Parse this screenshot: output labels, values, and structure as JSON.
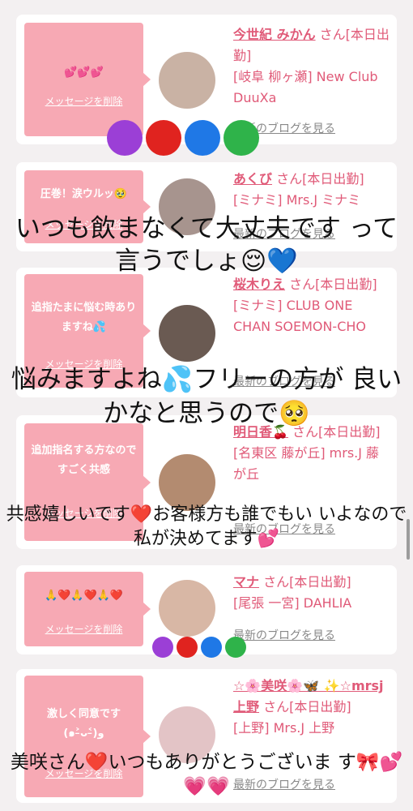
{
  "colors": {
    "background": "#f3f0f1",
    "bubble": "#f7a9b4",
    "accent": "#e05a78",
    "link_gray": "#888888"
  },
  "cards": [
    {
      "bubble_message": "💕💕💕",
      "delete_label": "メッセージを削除",
      "name": "今世紀 みかん",
      "suffix": "さん[本日出勤]",
      "shop": "[岐阜 柳ヶ瀬] New Club DuuXa",
      "blog_label": "最新のブログを見る"
    },
    {
      "bubble_message": "圧巻！涙ウルッ🥹",
      "delete_label": "メッセージを削除",
      "name": "あくび",
      "suffix": "さん[本日出勤]",
      "shop": "[ミナミ] Mrs.J ミナミ",
      "blog_label": "最新のブログを見る"
    },
    {
      "bubble_message": "追指たまに悩む時ありますね💦",
      "delete_label": "メッセージを削除",
      "name": "桜木りえ",
      "suffix": "さん[本日出勤]",
      "shop": "[ミナミ] CLUB ONE CHAN SOEMON-CHO",
      "blog_label": "最新のブログを見る"
    },
    {
      "bubble_message": "追加指名する方なのですごく共感",
      "delete_label": "メッセージを削除",
      "name": "明日香🍒",
      "suffix": "さん[本日出勤]",
      "shop": "[名東区 藤が丘] mrs.J 藤が丘",
      "blog_label": "最新のブログを見る"
    },
    {
      "bubble_message": "🙏❤️🙏❤️🙏❤️",
      "delete_label": "メッセージを削除",
      "name": "マナ",
      "suffix": "さん[本日出勤]",
      "shop": "[尾張 一宮] DAHLIA",
      "blog_label": "最新のブログを見る"
    },
    {
      "bubble_message": "激しく同意です (๑˃̵ᴗ˂̵)و",
      "delete_label": "メッセージを削除",
      "name": "☆🌸美咲🌸🦋 ✨☆mrsj上野",
      "suffix": "さん[本日出勤]",
      "shop": "[上野] Mrs.J 上野",
      "blog_label": "最新のブログを見る"
    }
  ],
  "overlays": [
    {
      "text": "いつも飲まなくて大丈夫です って言うでしょ😌💙"
    },
    {
      "text": "悩みますよね💦フリーの方が 良いかなと思うので🥺"
    },
    {
      "text": "共感嬉しいです❤️お客様方も誰でもい いよなので私が決めてます💕"
    },
    {
      "text": "美咲さん❤️いつもありがとうございま す🎀💕💗💗"
    }
  ],
  "heart_rows": [
    {
      "colors": [
        "#9b3fd6",
        "#e0231f",
        "#1f78e6",
        "#2fb34a"
      ]
    },
    {
      "colors": [
        "#9b3fd6",
        "#e0231f",
        "#1f78e6",
        "#2fb34a"
      ]
    }
  ]
}
